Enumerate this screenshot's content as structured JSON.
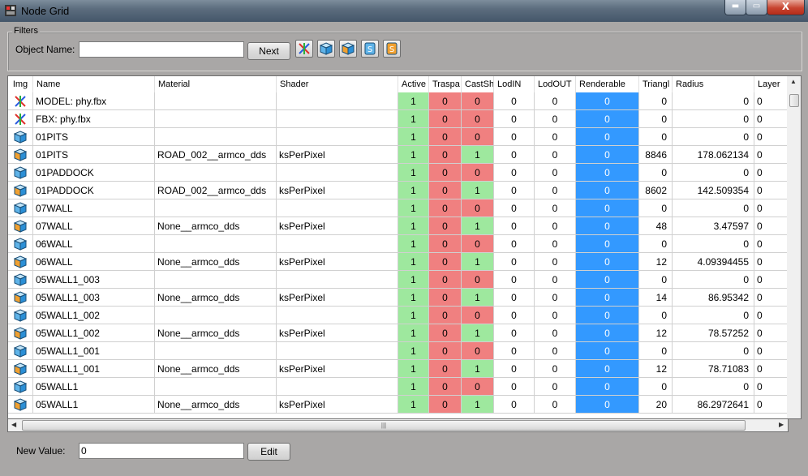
{
  "window": {
    "title": "Node Grid",
    "min_glyph": "▬",
    "max_glyph": "▭",
    "close_glyph": "X"
  },
  "filters": {
    "legend": "Filters",
    "object_name_label": "Object Name:",
    "object_name_value": "",
    "next_label": "Next",
    "icon_buttons": [
      "axes-icon",
      "cube-icon",
      "cube-orange-icon",
      "shader-icon",
      "shader-orange-icon"
    ]
  },
  "grid": {
    "columns": [
      "Img",
      "Name",
      "Material",
      "Shader",
      "Active",
      "Traspa",
      "CastSh",
      "LodIN",
      "LodOUT",
      "Renderable",
      "Triangl",
      "Radius",
      "Layer"
    ],
    "rows": [
      {
        "icon": "axes",
        "name": "MODEL: phy.fbx",
        "material": "",
        "shader": "",
        "active": "1",
        "transp": "0",
        "cast": "0",
        "lodin": "0",
        "lodout": "0",
        "render": "0",
        "tri": "0",
        "radius": "0",
        "layer": "0"
      },
      {
        "icon": "axes",
        "name": "FBX: phy.fbx",
        "material": "",
        "shader": "",
        "active": "1",
        "transp": "0",
        "cast": "0",
        "lodin": "0",
        "lodout": "0",
        "render": "0",
        "tri": "0",
        "radius": "0",
        "layer": "0"
      },
      {
        "icon": "cube",
        "name": "01PITS",
        "material": "",
        "shader": "",
        "active": "1",
        "transp": "0",
        "cast": "0",
        "lodin": "0",
        "lodout": "0",
        "render": "0",
        "tri": "0",
        "radius": "0",
        "layer": "0"
      },
      {
        "icon": "cube-orange",
        "name": "01PITS",
        "material": "ROAD_002__armco_dds",
        "shader": "ksPerPixel",
        "active": "1",
        "transp": "0",
        "cast": "1",
        "lodin": "0",
        "lodout": "0",
        "render": "0",
        "tri": "8846",
        "radius": "178.062134",
        "layer": "0"
      },
      {
        "icon": "cube",
        "name": "01PADDOCK",
        "material": "",
        "shader": "",
        "active": "1",
        "transp": "0",
        "cast": "0",
        "lodin": "0",
        "lodout": "0",
        "render": "0",
        "tri": "0",
        "radius": "0",
        "layer": "0"
      },
      {
        "icon": "cube-orange",
        "name": "01PADDOCK",
        "material": "ROAD_002__armco_dds",
        "shader": "ksPerPixel",
        "active": "1",
        "transp": "0",
        "cast": "1",
        "lodin": "0",
        "lodout": "0",
        "render": "0",
        "tri": "8602",
        "radius": "142.509354",
        "layer": "0"
      },
      {
        "icon": "cube",
        "name": "07WALL",
        "material": "",
        "shader": "",
        "active": "1",
        "transp": "0",
        "cast": "0",
        "lodin": "0",
        "lodout": "0",
        "render": "0",
        "tri": "0",
        "radius": "0",
        "layer": "0"
      },
      {
        "icon": "cube-orange",
        "name": "07WALL",
        "material": "None__armco_dds",
        "shader": "ksPerPixel",
        "active": "1",
        "transp": "0",
        "cast": "1",
        "lodin": "0",
        "lodout": "0",
        "render": "0",
        "tri": "48",
        "radius": "3.47597",
        "layer": "0"
      },
      {
        "icon": "cube",
        "name": "06WALL",
        "material": "",
        "shader": "",
        "active": "1",
        "transp": "0",
        "cast": "0",
        "lodin": "0",
        "lodout": "0",
        "render": "0",
        "tri": "0",
        "radius": "0",
        "layer": "0"
      },
      {
        "icon": "cube-orange",
        "name": "06WALL",
        "material": "None__armco_dds",
        "shader": "ksPerPixel",
        "active": "1",
        "transp": "0",
        "cast": "1",
        "lodin": "0",
        "lodout": "0",
        "render": "0",
        "tri": "12",
        "radius": "4.09394455",
        "layer": "0"
      },
      {
        "icon": "cube",
        "name": "05WALL1_003",
        "material": "",
        "shader": "",
        "active": "1",
        "transp": "0",
        "cast": "0",
        "lodin": "0",
        "lodout": "0",
        "render": "0",
        "tri": "0",
        "radius": "0",
        "layer": "0"
      },
      {
        "icon": "cube-orange",
        "name": "05WALL1_003",
        "material": "None__armco_dds",
        "shader": "ksPerPixel",
        "active": "1",
        "transp": "0",
        "cast": "1",
        "lodin": "0",
        "lodout": "0",
        "render": "0",
        "tri": "14",
        "radius": "86.95342",
        "layer": "0"
      },
      {
        "icon": "cube",
        "name": "05WALL1_002",
        "material": "",
        "shader": "",
        "active": "1",
        "transp": "0",
        "cast": "0",
        "lodin": "0",
        "lodout": "0",
        "render": "0",
        "tri": "0",
        "radius": "0",
        "layer": "0"
      },
      {
        "icon": "cube-orange",
        "name": "05WALL1_002",
        "material": "None__armco_dds",
        "shader": "ksPerPixel",
        "active": "1",
        "transp": "0",
        "cast": "1",
        "lodin": "0",
        "lodout": "0",
        "render": "0",
        "tri": "12",
        "radius": "78.57252",
        "layer": "0"
      },
      {
        "icon": "cube",
        "name": "05WALL1_001",
        "material": "",
        "shader": "",
        "active": "1",
        "transp": "0",
        "cast": "0",
        "lodin": "0",
        "lodout": "0",
        "render": "0",
        "tri": "0",
        "radius": "0",
        "layer": "0"
      },
      {
        "icon": "cube-orange",
        "name": "05WALL1_001",
        "material": "None__armco_dds",
        "shader": "ksPerPixel",
        "active": "1",
        "transp": "0",
        "cast": "1",
        "lodin": "0",
        "lodout": "0",
        "render": "0",
        "tri": "12",
        "radius": "78.71083",
        "layer": "0"
      },
      {
        "icon": "cube",
        "name": "05WALL1",
        "material": "",
        "shader": "",
        "active": "1",
        "transp": "0",
        "cast": "0",
        "lodin": "0",
        "lodout": "0",
        "render": "0",
        "tri": "0",
        "radius": "0",
        "layer": "0"
      },
      {
        "icon": "cube-orange",
        "name": "05WALL1",
        "material": "None__armco_dds",
        "shader": "ksPerPixel",
        "active": "1",
        "transp": "0",
        "cast": "1",
        "lodin": "0",
        "lodout": "0",
        "render": "0",
        "tri": "20",
        "radius": "86.2972641",
        "layer": "0"
      }
    ]
  },
  "edit": {
    "new_value_label": "New Value:",
    "new_value": "0",
    "edit_label": "Edit"
  },
  "colors": {
    "active_green": "#9ee89e",
    "red": "#f08080",
    "renderable_blue": "#3399ff",
    "cast_green": "#9ee89e"
  }
}
